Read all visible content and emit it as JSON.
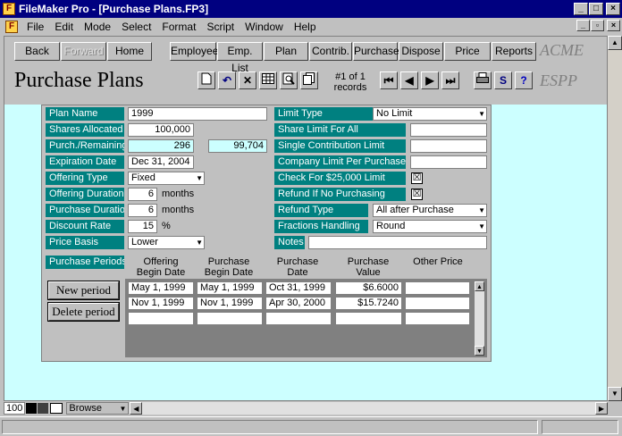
{
  "window": {
    "title": "FileMaker Pro - [Purchase Plans.FP3]",
    "app_icon": "filemaker-icon"
  },
  "menu": [
    "File",
    "Edit",
    "Mode",
    "Select",
    "Format",
    "Script",
    "Window",
    "Help"
  ],
  "nav": {
    "back": "Back",
    "forward": "Forward",
    "home": "Home",
    "employee": "Employee",
    "emp_list": "Emp. List",
    "plan": "Plan",
    "contrib": "Contrib.",
    "purchase": "Purchase",
    "dispose": "Dispose",
    "price": "Price",
    "reports": "Reports"
  },
  "logo": {
    "acme": "ACME",
    "espp": "ESPP"
  },
  "layout_title": "Purchase Plans",
  "records": {
    "line1": "#1 of 1",
    "line2": "records"
  },
  "toolbar_icons": [
    "new-record-icon",
    "undo-icon",
    "delete-icon",
    "table-view-icon",
    "find-icon",
    "copy-icon"
  ],
  "record_nav_icons": [
    "first-record-icon",
    "previous-record-icon",
    "next-record-icon",
    "last-record-icon"
  ],
  "utility_icons": [
    "print-icon",
    "script-icon",
    "help-icon"
  ],
  "form": {
    "left": [
      {
        "label": "Plan Name",
        "value": "1999"
      },
      {
        "label": "Shares Allocated",
        "value": "100,000"
      },
      {
        "label": "Purch./Remaining",
        "value": "296",
        "value2": "99,704"
      },
      {
        "label": "Expiration Date",
        "value": "Dec 31, 2004"
      },
      {
        "label": "Offering Type",
        "value": "Fixed"
      },
      {
        "label": "Offering Duration",
        "value": "6",
        "unit": "months"
      },
      {
        "label": "Purchase Duration",
        "value": "6",
        "unit": "months"
      },
      {
        "label": "Discount Rate",
        "value": "15",
        "unit": "%"
      },
      {
        "label": "Price Basis",
        "value": "Lower"
      }
    ],
    "right": [
      {
        "label": "Limit Type",
        "value": "No Limit"
      },
      {
        "label": "Share Limit For All",
        "value": ""
      },
      {
        "label": "Single Contribution Limit",
        "value": ""
      },
      {
        "label": "Company Limit Per Purchase",
        "value": ""
      },
      {
        "label": "Check For $25,000 Limit",
        "value": "☒"
      },
      {
        "label": "Refund If No Purchasing",
        "value": "☒"
      },
      {
        "label": "Refund Type",
        "value": "All after Purchase"
      },
      {
        "label": "Fractions Handling",
        "value": "Round"
      },
      {
        "label": "Notes",
        "value": ""
      }
    ]
  },
  "periods": {
    "label": "Purchase Periods",
    "headers": {
      "offering_begin": [
        "Offering",
        "Begin Date"
      ],
      "purchase_begin": [
        "Purchase",
        "Begin Date"
      ],
      "purchase_date": [
        "Purchase",
        "Date"
      ],
      "purchase_value": [
        "Purchase",
        "Value"
      ],
      "other_price": [
        "",
        "Other Price"
      ]
    },
    "new_button": "New period",
    "delete_button": "Delete period",
    "rows": [
      {
        "offering_begin": "May 1, 1999",
        "purchase_begin": "May 1, 1999",
        "purchase_date": "Oct 31, 1999",
        "purchase_value": "$6.6000",
        "other_price": ""
      },
      {
        "offering_begin": "Nov 1, 1999",
        "purchase_begin": "Nov 1, 1999",
        "purchase_date": "Apr 30, 2000",
        "purchase_value": "$15.7240",
        "other_price": ""
      },
      {
        "offering_begin": "",
        "purchase_begin": "",
        "purchase_date": "",
        "purchase_value": "",
        "other_price": ""
      }
    ]
  },
  "status": {
    "zoom": "100",
    "mode": "Browse"
  }
}
